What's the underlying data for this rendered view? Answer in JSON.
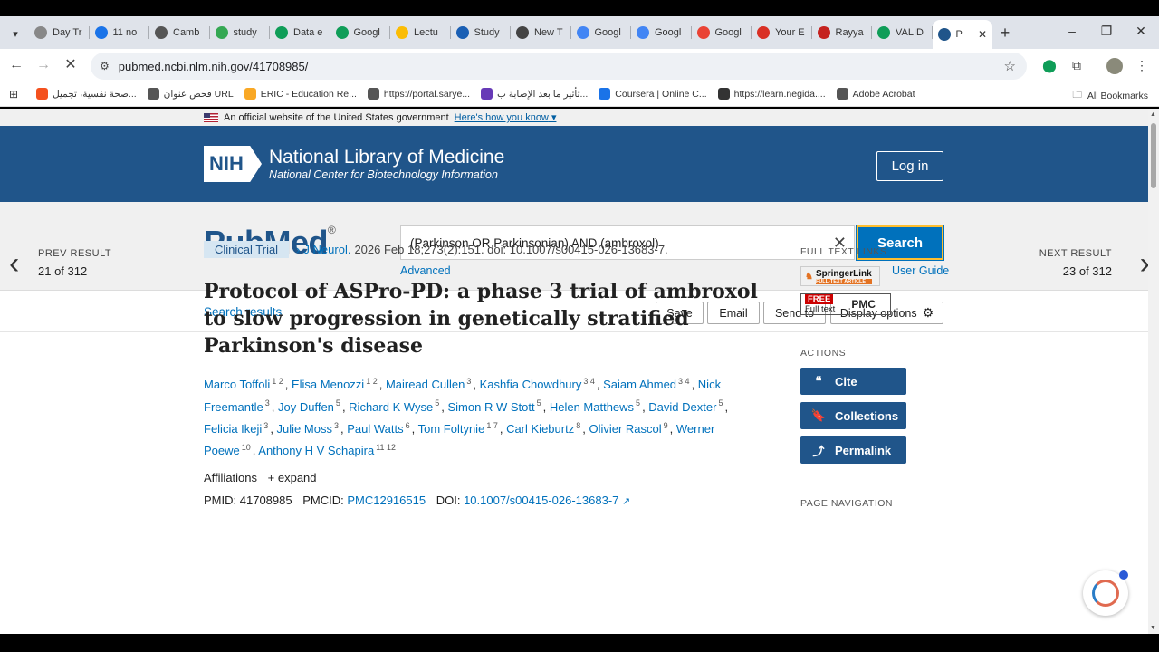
{
  "browser": {
    "tabs": [
      {
        "label": "Day Tr",
        "color": "#888"
      },
      {
        "label": "11 no",
        "color": "#1a73e8"
      },
      {
        "label": "Camb",
        "color": "#555"
      },
      {
        "label": "study",
        "color": "#34a853"
      },
      {
        "label": "Data e",
        "color": "#0f9d58"
      },
      {
        "label": "Googl",
        "color": "#0f9d58"
      },
      {
        "label": "Lectu",
        "color": "#fbbc04"
      },
      {
        "label": "Study",
        "color": "#1a5fb4"
      },
      {
        "label": "New T",
        "color": "#444"
      },
      {
        "label": "Googl",
        "color": "#4285f4"
      },
      {
        "label": "Googl",
        "color": "#4285f4"
      },
      {
        "label": "Googl",
        "color": "#ea4335"
      },
      {
        "label": "Your E",
        "color": "#d93025"
      },
      {
        "label": "Rayya",
        "color": "#c5221f"
      },
      {
        "label": "VALID",
        "color": "#0f9d58"
      },
      {
        "label": "P",
        "color": "#20558a",
        "active": true
      }
    ],
    "url": "pubmed.ncbi.nlm.nih.gov/41708985/",
    "ext_badge": "1",
    "bookmarks": [
      {
        "label": "صحة نفسية، تجميل...",
        "color": "#f4511e"
      },
      {
        "label": "فحص عنوان URL",
        "color": "#555"
      },
      {
        "label": "ERIC - Education Re...",
        "color": "#f9a825"
      },
      {
        "label": "https://portal.sarye...",
        "color": "#555"
      },
      {
        "label": "تأثير ما بعد الإصابة ب...",
        "color": "#673ab7"
      },
      {
        "label": "Coursera | Online C...",
        "color": "#1a73e8"
      },
      {
        "label": "https://learn.negida....",
        "color": "#333"
      },
      {
        "label": "Adobe Acrobat",
        "color": "#555"
      }
    ],
    "all_bookmarks": "All Bookmarks"
  },
  "gov_banner": {
    "text": "An official website of the United States government",
    "link": "Here's how you know"
  },
  "header": {
    "nih": "NIH",
    "title": "National Library of Medicine",
    "subtitle": "National Center for Biotechnology Information",
    "login": "Log in"
  },
  "search": {
    "logo": "PubMed",
    "reg": "®",
    "query": "(Parkinson OR Parkinsonian) AND (ambroxol)",
    "button": "Search",
    "advanced": "Advanced",
    "user_guide": "User Guide"
  },
  "actions": {
    "search_results": "Search results",
    "save": "Save",
    "email": "Email",
    "send_to": "Send to",
    "display_options": "Display options"
  },
  "nav": {
    "prev_label": "PREV RESULT",
    "prev_count": "21 of 312",
    "next_label": "NEXT RESULT",
    "next_count": "23 of 312"
  },
  "article": {
    "type": "Clinical Trial",
    "journal": "J Neurol.",
    "citation": "2026 Feb 18;273(2):151. doi: 10.1007/s00415-026-13683-7.",
    "title": "Protocol of ASPro-PD: a phase 3 trial of ambroxol to slow progression in genetically stratified Parkinson's disease",
    "authors": [
      {
        "name": "Marco Toffoli",
        "aff": "1 2"
      },
      {
        "name": "Elisa Menozzi",
        "aff": "1 2"
      },
      {
        "name": "Mairead Cullen",
        "aff": "3"
      },
      {
        "name": "Kashfia Chowdhury",
        "aff": "3 4"
      },
      {
        "name": "Saiam Ahmed",
        "aff": "3 4"
      },
      {
        "name": "Nick Freemantle",
        "aff": "3"
      },
      {
        "name": "Joy Duffen",
        "aff": "5"
      },
      {
        "name": "Richard K Wyse",
        "aff": "5"
      },
      {
        "name": "Simon R W Stott",
        "aff": "5"
      },
      {
        "name": "Helen Matthews",
        "aff": "5"
      },
      {
        "name": "David Dexter",
        "aff": "5"
      },
      {
        "name": "Felicia Ikeji",
        "aff": "3"
      },
      {
        "name": "Julie Moss",
        "aff": "3"
      },
      {
        "name": "Paul Watts",
        "aff": "6"
      },
      {
        "name": "Tom Foltynie",
        "aff": "1 7"
      },
      {
        "name": "Carl Kieburtz",
        "aff": "8"
      },
      {
        "name": "Olivier Rascol",
        "aff": "9"
      },
      {
        "name": "Werner Poewe",
        "aff": "10"
      },
      {
        "name": "Anthony H V Schapira",
        "aff": "11 12"
      }
    ],
    "affiliations_label": "Affiliations",
    "expand": "expand",
    "pmid_label": "PMID:",
    "pmid": "41708985",
    "pmcid_label": "PMCID:",
    "pmcid": "PMC12916515",
    "doi_label": "DOI:",
    "doi": "10.1007/s00415-026-13683-7"
  },
  "sidebar": {
    "full_text_links": "FULL TEXT LINKS",
    "springer": "SpringerLink",
    "springer_sub": "FULL-TEXT ARTICLE",
    "pmc_free": "FREE",
    "pmc_full": "Full text",
    "pmc": "PMC",
    "actions": "ACTIONS",
    "cite": "Cite",
    "collections": "Collections",
    "permalink": "Permalink",
    "page_navigation": "PAGE NAVIGATION"
  }
}
